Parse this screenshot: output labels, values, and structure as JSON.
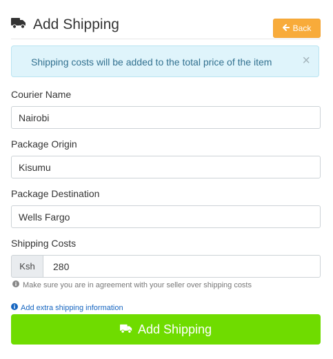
{
  "header": {
    "title": "Add Shipping",
    "title_icon": "truck-icon",
    "back_label": "Back",
    "back_icon": "arrow-left-icon"
  },
  "alert": {
    "text": "Shipping costs will be added to the total price of the item",
    "close_symbol": "×"
  },
  "form": {
    "courier_name": {
      "label": "Courier Name",
      "value": "Nairobi"
    },
    "package_origin": {
      "label": "Package Origin",
      "value": "Kisumu"
    },
    "package_destination": {
      "label": "Package Destination",
      "value": "Wells Fargo"
    },
    "shipping_costs": {
      "label": "Shipping Costs",
      "currency": "Ksh",
      "value": "280"
    },
    "help_text": "Make sure you are in agreement with your seller over shipping costs",
    "help_icon": "info-circle-icon"
  },
  "extra_link": {
    "label": "Add extra shipping information",
    "icon": "info-circle-icon"
  },
  "submit": {
    "label": "Add Shipping",
    "icon": "truck-icon"
  },
  "colors": {
    "back_button": "#f8ab3a",
    "submit_button": "#6fdc00",
    "alert_bg": "#dff4fb",
    "alert_text": "#31708f",
    "link": "#1565c0"
  }
}
